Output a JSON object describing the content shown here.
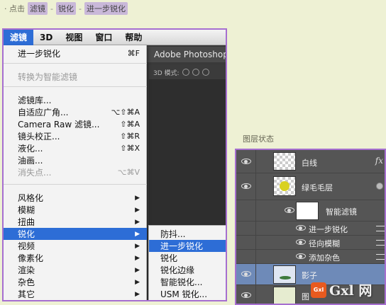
{
  "instruction": {
    "prefix": "· 点击",
    "step1": "滤镜",
    "sep1": "-",
    "step2": "锐化",
    "sep2": "-",
    "step3": "进一步锐化"
  },
  "menubar": {
    "items": [
      "滤镜",
      "3D",
      "视图",
      "窗口",
      "帮助"
    ]
  },
  "photoshop": {
    "title": "Adobe Photoshop C",
    "mode_label": "3D 模式:"
  },
  "filter_menu": {
    "items": [
      {
        "label": "进一步锐化",
        "shortcut": "⌘F"
      },
      {
        "label": "转换为智能滤镜",
        "shortcut": ""
      },
      {
        "label": "滤镜库...",
        "shortcut": ""
      },
      {
        "label": "自适应广角...",
        "shortcut": "⌥⇧⌘A"
      },
      {
        "label": "Camera Raw 滤镜...",
        "shortcut": "⇧⌘A"
      },
      {
        "label": "镜头校正...",
        "shortcut": "⇧⌘R"
      },
      {
        "label": "液化...",
        "shortcut": "⇧⌘X"
      },
      {
        "label": "油画...",
        "shortcut": ""
      },
      {
        "label": "消失点...",
        "shortcut": "⌥⌘V"
      },
      {
        "label": "风格化",
        "shortcut": "▶"
      },
      {
        "label": "模糊",
        "shortcut": "▶"
      },
      {
        "label": "扭曲",
        "shortcut": "▶"
      },
      {
        "label": "锐化",
        "shortcut": "▶"
      },
      {
        "label": "视频",
        "shortcut": "▶"
      },
      {
        "label": "像素化",
        "shortcut": "▶"
      },
      {
        "label": "渲染",
        "shortcut": "▶"
      },
      {
        "label": "杂色",
        "shortcut": "▶"
      },
      {
        "label": "其它",
        "shortcut": "▶"
      }
    ]
  },
  "sharpen_submenu": {
    "items": [
      "防抖...",
      "进一步锐化",
      "锐化",
      "锐化边缘",
      "智能锐化...",
      "USM 锐化..."
    ]
  },
  "layers": {
    "caption": "图层状态",
    "rows": [
      "白线",
      "绿毛毛层",
      "智能滤镜",
      "进一步锐化",
      "径向模糊",
      "添加杂色",
      "影子",
      "图"
    ],
    "fx_label": "fx"
  },
  "watermark": {
    "logo": "Gxl",
    "text": "Gxl 网"
  },
  "colors": {
    "accent": "#2d6dd6",
    "frame": "#a66fd0",
    "background": "#eef1d4"
  }
}
